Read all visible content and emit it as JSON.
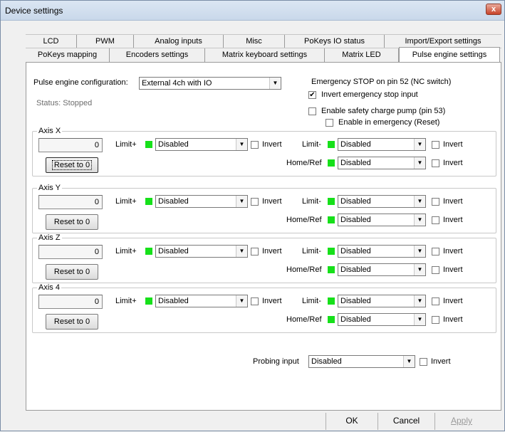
{
  "window": {
    "title": "Device settings",
    "close": "x"
  },
  "tabs_row1": [
    "LCD",
    "PWM",
    "Analog inputs",
    "Misc",
    "PoKeys IO status",
    "Import/Export settings"
  ],
  "tabs_row2": [
    "PoKeys mapping",
    "Encoders settings",
    "Matrix keyboard settings",
    "Matrix LED",
    "Pulse engine settings"
  ],
  "active_tab": "Pulse engine settings",
  "config": {
    "label": "Pulse engine configuration:",
    "value": "External 4ch with IO",
    "status": "Status: Stopped"
  },
  "estop": {
    "title": "Emergency STOP on pin 52 (NC switch)",
    "invert_label": "Invert emergency stop input",
    "invert_checked": true,
    "charge_label": "Enable safety charge pump (pin 53)",
    "charge_checked": false,
    "emergency_label": "Enable in emergency (Reset)",
    "emergency_checked": false
  },
  "labels": {
    "limit_plus": "Limit+",
    "limit_minus": "Limit-",
    "home": "Home/Ref",
    "invert": "Invert",
    "reset": "Reset to 0"
  },
  "axes": [
    {
      "name": "Axis X",
      "value": "0",
      "limit_plus": "Disabled",
      "limit_minus": "Disabled",
      "home": "Disabled"
    },
    {
      "name": "Axis Y",
      "value": "0",
      "limit_plus": "Disabled",
      "limit_minus": "Disabled",
      "home": "Disabled"
    },
    {
      "name": "Axis Z",
      "value": "0",
      "limit_plus": "Disabled",
      "limit_minus": "Disabled",
      "home": "Disabled"
    },
    {
      "name": "Axis 4",
      "value": "0",
      "limit_plus": "Disabled",
      "limit_minus": "Disabled",
      "home": "Disabled"
    }
  ],
  "probing": {
    "label": "Probing input",
    "value": "Disabled",
    "invert": "Invert"
  },
  "buttons": {
    "ok": "OK",
    "cancel": "Cancel",
    "apply": "Apply"
  },
  "colors": {
    "led": "#16e01a",
    "titlebar": "#c9d8ea",
    "close": "#c7432a"
  }
}
